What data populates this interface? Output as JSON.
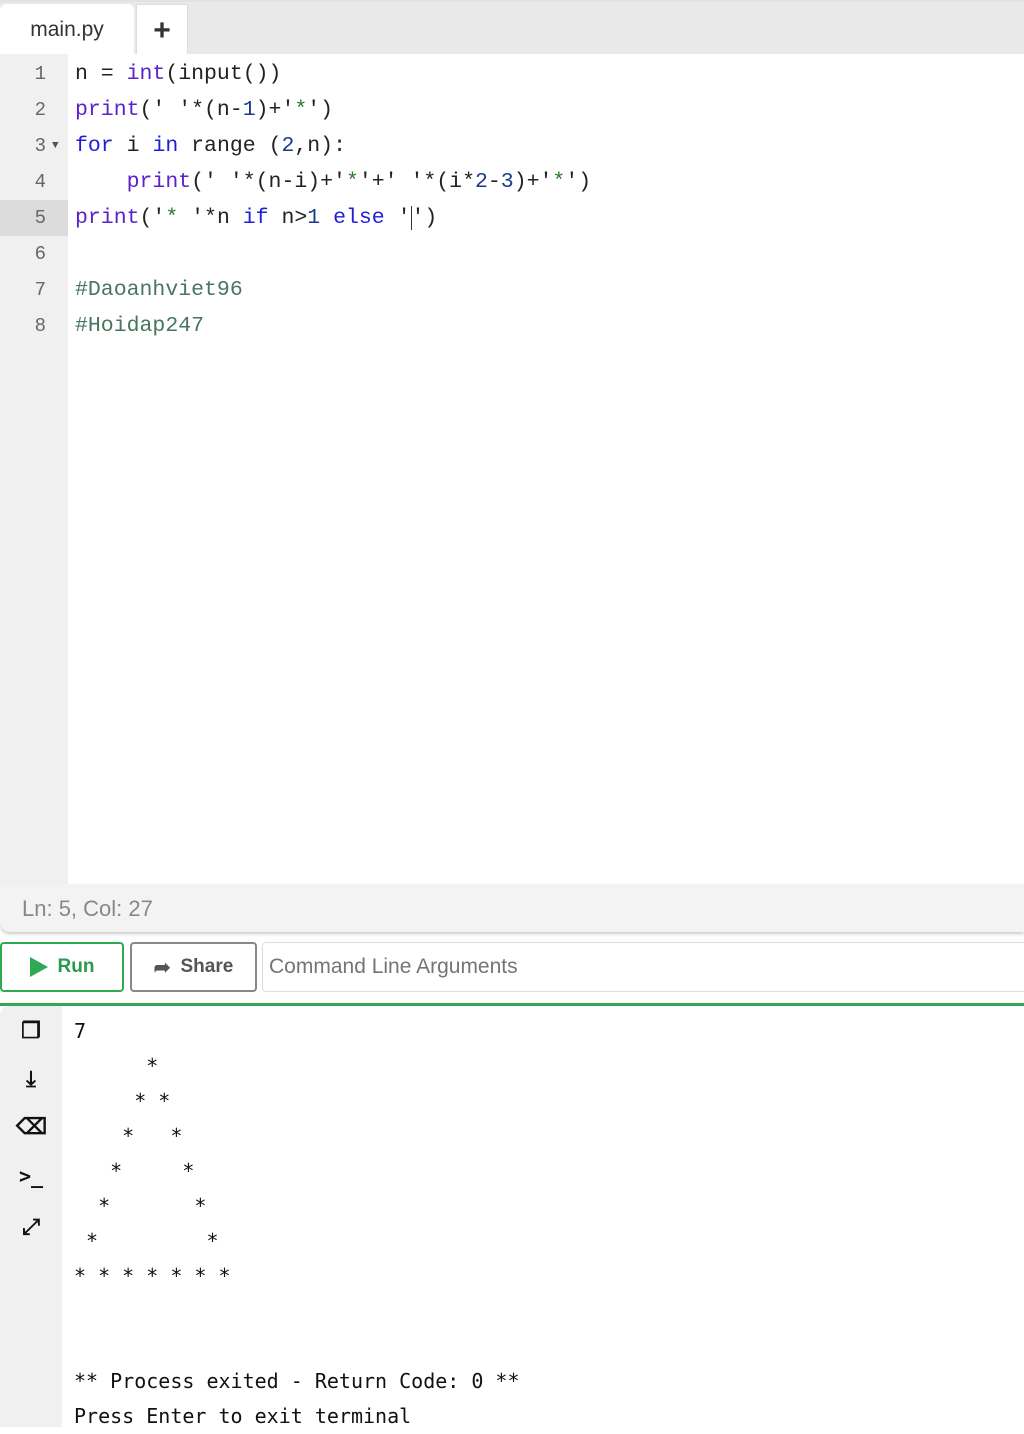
{
  "tabs": {
    "file": "main.py",
    "add": "+"
  },
  "editor": {
    "lines": [
      {
        "n": "1",
        "code": "n = int(input())"
      },
      {
        "n": "2",
        "code": "print(' '*(n-1)+'*')"
      },
      {
        "n": "3",
        "code": "for i in range (2,n):"
      },
      {
        "n": "4",
        "code": "    print(' '*(n-i)+'*'+' '*(i*2-3)+'*')"
      },
      {
        "n": "5",
        "code": "print('* '*n if n>1 else '')"
      },
      {
        "n": "6",
        "code": ""
      },
      {
        "n": "7",
        "code": "#Daoanhviet96"
      },
      {
        "n": "8",
        "code": "#Hoidap247"
      }
    ]
  },
  "status": "Ln: 5,  Col: 27",
  "toolbar": {
    "run": "Run",
    "share": "Share",
    "args_placeholder": "Command Line Arguments"
  },
  "terminal": {
    "output": "7\n      *\n     * *\n    *   *\n   *     *\n  *       *\n *         *\n* * * * * * *\n\n\n** Process exited - Return Code: 0 **\nPress Enter to exit terminal"
  },
  "colors": {
    "accent": "#2eaa55"
  }
}
